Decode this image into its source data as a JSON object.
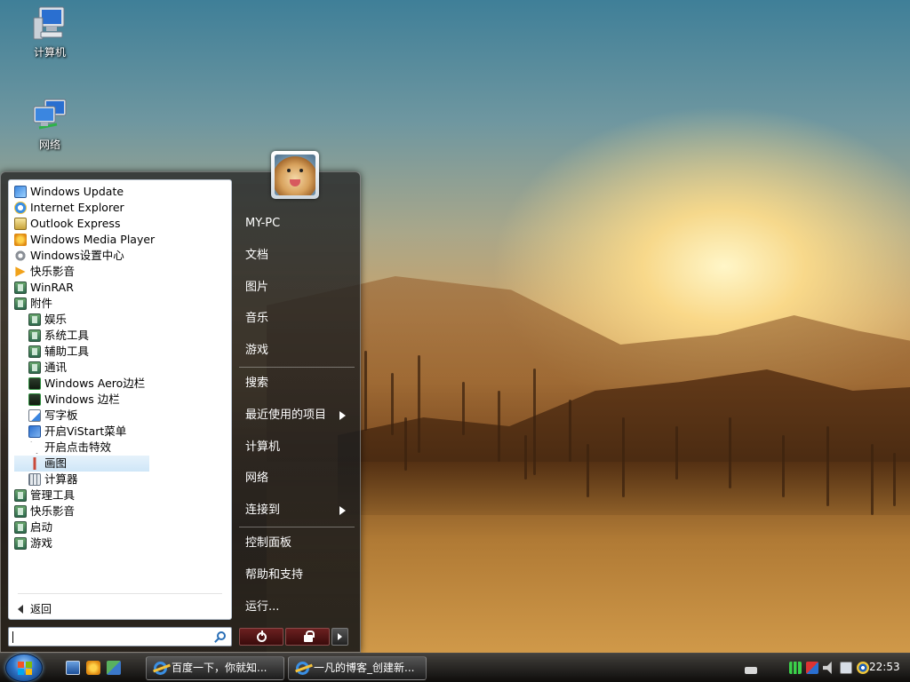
{
  "desktop": {
    "icons": [
      {
        "label": "计算机",
        "icon": "computer-icon"
      },
      {
        "label": "网络",
        "icon": "network-icon"
      }
    ]
  },
  "start_menu": {
    "programs": [
      {
        "label": "Windows Update",
        "icon": "windows-update-icon",
        "indent": 0
      },
      {
        "label": "Internet Explorer",
        "icon": "ie-icon",
        "indent": 0
      },
      {
        "label": "Outlook Express",
        "icon": "outlook-icon",
        "indent": 0
      },
      {
        "label": "Windows Media Player",
        "icon": "media-player-icon",
        "indent": 0
      },
      {
        "label": "Windows设置中心",
        "icon": "settings-gear-icon",
        "indent": 0
      },
      {
        "label": "快乐影音",
        "icon": "play-icon",
        "indent": 0
      },
      {
        "label": "WinRAR",
        "icon": "folder-icon",
        "indent": 0
      },
      {
        "label": "附件",
        "icon": "folder-icon",
        "indent": 0
      },
      {
        "label": "娱乐",
        "icon": "folder-icon",
        "indent": 1
      },
      {
        "label": "系统工具",
        "icon": "folder-icon",
        "indent": 1
      },
      {
        "label": "辅助工具",
        "icon": "folder-icon",
        "indent": 1
      },
      {
        "label": "通讯",
        "icon": "folder-icon",
        "indent": 1
      },
      {
        "label": "Windows Aero边栏",
        "icon": "sidebar-icon",
        "indent": 1
      },
      {
        "label": "Windows 边栏",
        "icon": "sidebar-icon",
        "indent": 1
      },
      {
        "label": "写字板",
        "icon": "wordpad-icon",
        "indent": 1
      },
      {
        "label": "开启ViStart菜单",
        "icon": "start-icon",
        "indent": 1
      },
      {
        "label": "开启点击特效",
        "icon": "cursor-icon",
        "indent": 1
      },
      {
        "label": "画图",
        "icon": "paint-icon",
        "indent": 1,
        "selected": true
      },
      {
        "label": "计算器",
        "icon": "calculator-icon",
        "indent": 1
      },
      {
        "label": "管理工具",
        "icon": "folder-icon",
        "indent": 0
      },
      {
        "label": "快乐影音",
        "icon": "folder-icon",
        "indent": 0
      },
      {
        "label": "启动",
        "icon": "folder-icon",
        "indent": 0
      },
      {
        "label": "游戏",
        "icon": "folder-icon",
        "indent": 0
      }
    ],
    "back_label": "返回",
    "search_value": "",
    "right_items": [
      {
        "label": "MY-PC",
        "submenu": false
      },
      {
        "label": "文档",
        "submenu": false
      },
      {
        "label": "图片",
        "submenu": false
      },
      {
        "label": "音乐",
        "submenu": false
      },
      {
        "label": "游戏",
        "submenu": false,
        "separator_after": true
      },
      {
        "label": "搜索",
        "submenu": false
      },
      {
        "label": "最近使用的项目",
        "submenu": true
      },
      {
        "label": "计算机",
        "submenu": false
      },
      {
        "label": "网络",
        "submenu": false
      },
      {
        "label": "连接到",
        "submenu": true,
        "separator_after": true
      },
      {
        "label": "控制面板",
        "submenu": false
      },
      {
        "label": "帮助和支持",
        "submenu": false
      },
      {
        "label": "运行...",
        "submenu": false
      }
    ]
  },
  "taskbar": {
    "quick_launch": [
      "show-desktop-icon",
      "media-player-icon",
      "switch-windows-icon"
    ],
    "tasks": [
      {
        "label": "百度一下，你就知...",
        "icon": "ie-icon"
      },
      {
        "label": "一凡的博客_创建新...",
        "icon": "ie-icon"
      }
    ],
    "tray_icons": [
      "keyboard-icon",
      "network-signal-icon",
      "shield-icon",
      "volume-icon",
      "display-icon",
      "wireless-icon"
    ],
    "clock": "22:53"
  },
  "colors": {
    "accent": "#2e73c7",
    "selected_bg": "#cfe6f8"
  }
}
